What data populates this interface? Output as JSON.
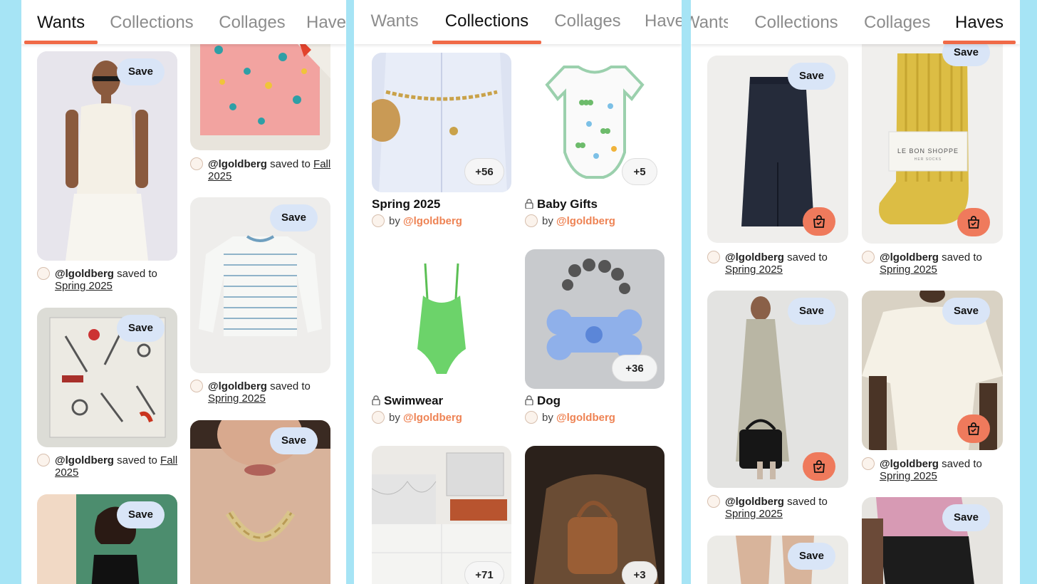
{
  "tabs": [
    "Wants",
    "Collections",
    "Collages",
    "Haves"
  ],
  "save_label": "Save",
  "saved_to_text": "saved to",
  "by_text": "by",
  "username": "@lgoldberg",
  "colors": {
    "accent": "#f06a47",
    "save_bg": "#d9e5f7",
    "username": "#ee8354",
    "background": "#a6e4f5"
  },
  "wants": {
    "col1": [
      {
        "image": "woman-white-tank-top",
        "board": "Spring 2025"
      },
      {
        "image": "hardware-tools-scarf",
        "board": "Fall 2025"
      },
      {
        "image": "woman-black-tank-green-door"
      }
    ],
    "col2": [
      {
        "image": "pink-bone-print-scarf",
        "board": "Fall 2025"
      },
      {
        "image": "striped-long-sleeve-tee",
        "board": "Spring 2025"
      },
      {
        "image": "gold-chain-necklace"
      }
    ]
  },
  "collections": [
    {
      "name": "Spring 2025",
      "count": "+56",
      "locked": false,
      "image": "belted-white-shirt"
    },
    {
      "name": "Baby Gifts",
      "count": "+5",
      "locked": true,
      "image": "caterpillar-onesie"
    },
    {
      "name": "Swimwear",
      "count": "",
      "locked": true,
      "image": "green-swimsuit"
    },
    {
      "name": "Dog",
      "count": "+36",
      "locked": true,
      "image": "bone-poop-bag-holder"
    },
    {
      "name": "",
      "count": "+71",
      "image": "marble-kitchen"
    },
    {
      "name": "",
      "count": "+3",
      "image": "brown-leather-bag"
    }
  ],
  "haves": {
    "col1": [
      {
        "image": "navy-midi-skirt",
        "board": "Spring 2025",
        "bag": true
      },
      {
        "image": "trench-coat-black-bag",
        "board": "Spring 2025",
        "bag": true
      },
      {
        "image": "bare-legs"
      }
    ],
    "col2": [
      {
        "image": "yellow-ribbed-socks",
        "board": "Spring 2025",
        "bag": true
      },
      {
        "image": "cream-draped-top",
        "board": "Spring 2025",
        "bag": true
      },
      {
        "image": "pink-shirt-black-skirt"
      }
    ],
    "sock_label": "LE BON SHOPPE",
    "sock_sublabel": "HER SOCKS"
  }
}
